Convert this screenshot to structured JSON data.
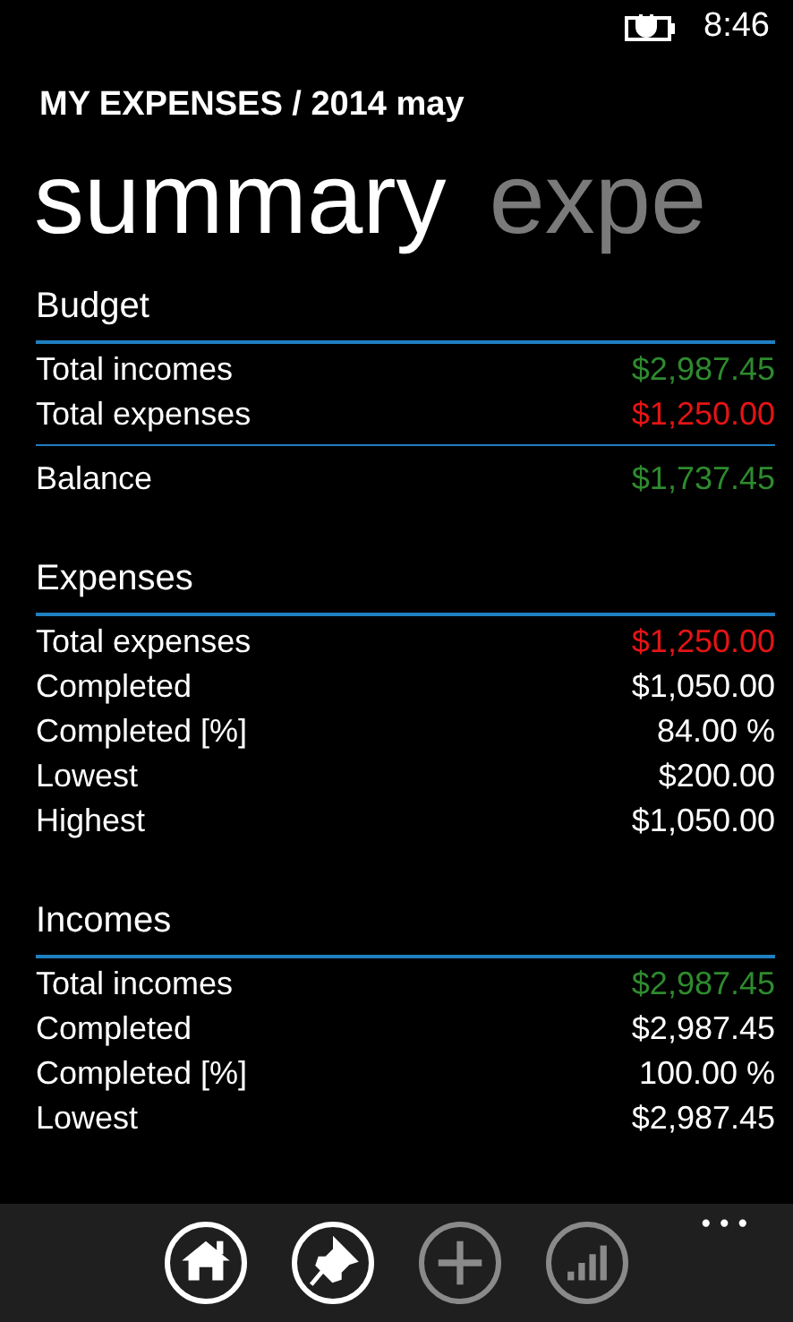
{
  "status_bar": {
    "time": "8:46"
  },
  "app_title": "MY EXPENSES / 2014 may",
  "pivot": [
    {
      "label": "summary",
      "selected": true
    },
    {
      "label": "expe",
      "selected": false
    }
  ],
  "sections": [
    {
      "title": "Budget",
      "rows": [
        {
          "label": "Total incomes",
          "value": "$2,987.45",
          "color": "#2e8b2e"
        },
        {
          "label": "Total expenses",
          "value": "$1,250.00",
          "color": "#e51414"
        }
      ],
      "total": {
        "label": "Balance",
        "value": "$1,737.45",
        "color": "#2e8b2e"
      }
    },
    {
      "title": "Expenses",
      "rows": [
        {
          "label": "Total expenses",
          "value": "$1,250.00",
          "color": "#e51414"
        },
        {
          "label": "Completed",
          "value": "$1,050.00",
          "color": "#ffffff"
        },
        {
          "label": "Completed [%]",
          "value": "84.00 %",
          "color": "#ffffff"
        },
        {
          "label": "Lowest",
          "value": "$200.00",
          "color": "#ffffff"
        },
        {
          "label": "Highest",
          "value": "$1,050.00",
          "color": "#ffffff"
        }
      ]
    },
    {
      "title": "Incomes",
      "rows": [
        {
          "label": "Total incomes",
          "value": "$2,987.45",
          "color": "#2e8b2e"
        },
        {
          "label": "Completed",
          "value": "$2,987.45",
          "color": "#ffffff"
        },
        {
          "label": "Completed [%]",
          "value": "100.00 %",
          "color": "#ffffff"
        },
        {
          "label": "Lowest",
          "value": "$2,987.45",
          "color": "#ffffff"
        }
      ]
    }
  ],
  "app_bar": {
    "buttons": [
      {
        "kind": "home",
        "disabled": false
      },
      {
        "kind": "pin",
        "disabled": false
      },
      {
        "kind": "add",
        "disabled": true
      },
      {
        "kind": "chart",
        "disabled": true
      }
    ],
    "more": "•••"
  }
}
